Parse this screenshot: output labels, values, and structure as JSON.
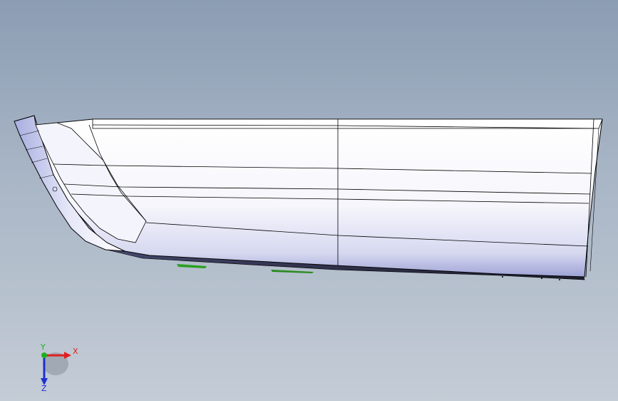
{
  "viewport": {
    "background_top": "#8b9db3",
    "background_bottom": "#c4ccd6"
  },
  "model": {
    "name": "boat-hull",
    "face_color": "#ffffff",
    "edge_color": "#000000",
    "shade_color": "#b8bde6"
  },
  "triad": {
    "x_label": "X",
    "y_label": "Y",
    "z_label": "Z",
    "x_color": "#e02020",
    "y_color": "#20b020",
    "z_color": "#2030d0"
  }
}
